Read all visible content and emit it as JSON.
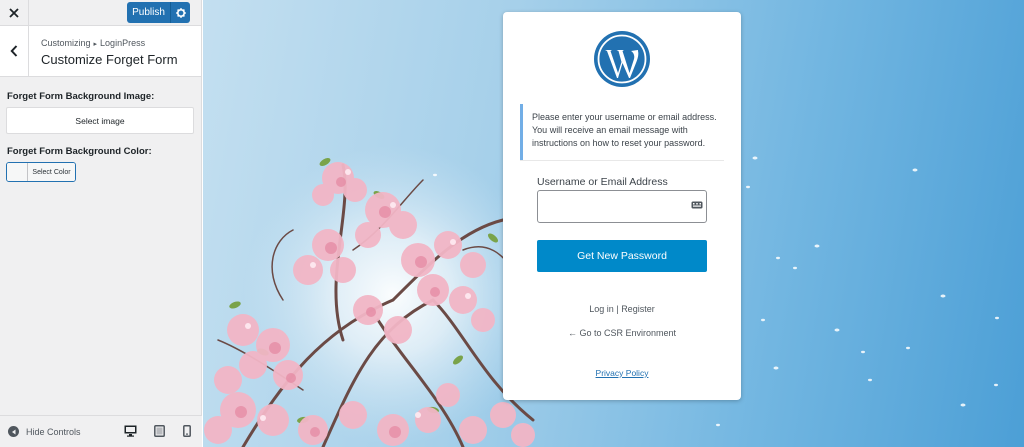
{
  "header": {
    "publish_label": "Publish"
  },
  "section": {
    "breadcrumb_parent": "Customizing",
    "breadcrumb_child": "LoginPress",
    "title": "Customize Forget Form"
  },
  "controls": {
    "bg_image_label": "Forget Form Background Image:",
    "select_image_label": "Select image",
    "bg_color_label": "Forget Form Background Color:",
    "select_color_label": "Select Color"
  },
  "footer": {
    "hide_controls_label": "Hide Controls",
    "devices": [
      "desktop-icon",
      "tablet-icon",
      "mobile-icon"
    ]
  },
  "login": {
    "message": "Please enter your username or email address. You will receive an email message with instructions on how to reset your password.",
    "field_label": "Username or Email Address",
    "field_value": "",
    "submit_label": "Get New Password",
    "login_link": "Log in",
    "separator": "|",
    "register_link": "Register",
    "back_link": "← Go to CSR Environment",
    "privacy_link": "Privacy Policy"
  },
  "colors": {
    "accent": "#2271b1",
    "submit": "#0089c9",
    "message_border": "#72aee6",
    "blossom": "#f2b6c6"
  }
}
